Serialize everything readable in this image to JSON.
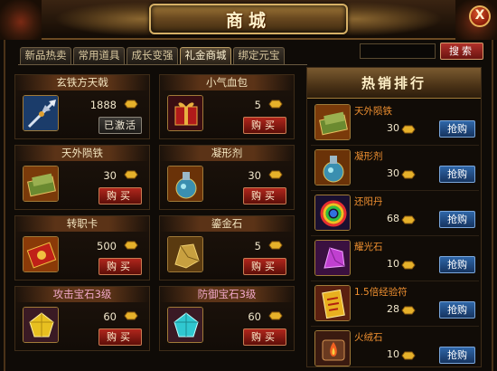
{
  "window": {
    "title": "商城",
    "close_label": "X"
  },
  "tabs": [
    {
      "label": "新品热卖"
    },
    {
      "label": "常用道具"
    },
    {
      "label": "成长变强"
    },
    {
      "label": "礼金商城",
      "active": true
    },
    {
      "label": "绑定元宝"
    }
  ],
  "search": {
    "value": "",
    "button_label": "搜索"
  },
  "items": [
    {
      "name": "玄铁方天戟",
      "price": "1888",
      "button": "已激活",
      "button_style": "gray",
      "icon": "halberd-icon"
    },
    {
      "name": "小气血包",
      "price": "5",
      "button": "购买",
      "icon": "red-gift-box-icon"
    },
    {
      "name": "天外陨铁",
      "price": "30",
      "button": "购买",
      "icon": "meteor-iron-icon"
    },
    {
      "name": "凝形剂",
      "price": "30",
      "button": "购买",
      "icon": "potion-flask-icon"
    },
    {
      "name": "转职卡",
      "price": "500",
      "button": "购买",
      "icon": "job-change-card-icon"
    },
    {
      "name": "鎏金石",
      "price": "5",
      "button": "购买",
      "icon": "gilded-stone-icon"
    },
    {
      "name": "攻击宝石3级",
      "price": "60",
      "button": "购买",
      "icon": "yellow-gem-icon",
      "name_color": "pink"
    },
    {
      "name": "防御宝石3级",
      "price": "60",
      "button": "购买",
      "icon": "cyan-gem-icon",
      "name_color": "pink"
    }
  ],
  "ranking": {
    "title": "热销排行",
    "items": [
      {
        "name": "天外陨铁",
        "price": "30",
        "button": "抢购",
        "icon": "meteor-iron-icon"
      },
      {
        "name": "凝形剂",
        "price": "30",
        "button": "抢购",
        "icon": "potion-flask-icon"
      },
      {
        "name": "还阳丹",
        "price": "68",
        "button": "抢购",
        "icon": "rainbow-pill-icon"
      },
      {
        "name": "耀光石",
        "price": "10",
        "button": "抢购",
        "icon": "purple-crystal-icon"
      },
      {
        "name": "1.5倍经验符",
        "price": "28",
        "button": "抢购",
        "icon": "exp-talisman-icon"
      },
      {
        "name": "火绒石",
        "price": "10",
        "button": "抢购",
        "icon": "fire-stone-icon"
      }
    ]
  },
  "colors": {
    "buy_button": "#8a1a12",
    "grab_button": "#23508a",
    "rank_name": "#f09030",
    "frame": "#6b4a22"
  }
}
